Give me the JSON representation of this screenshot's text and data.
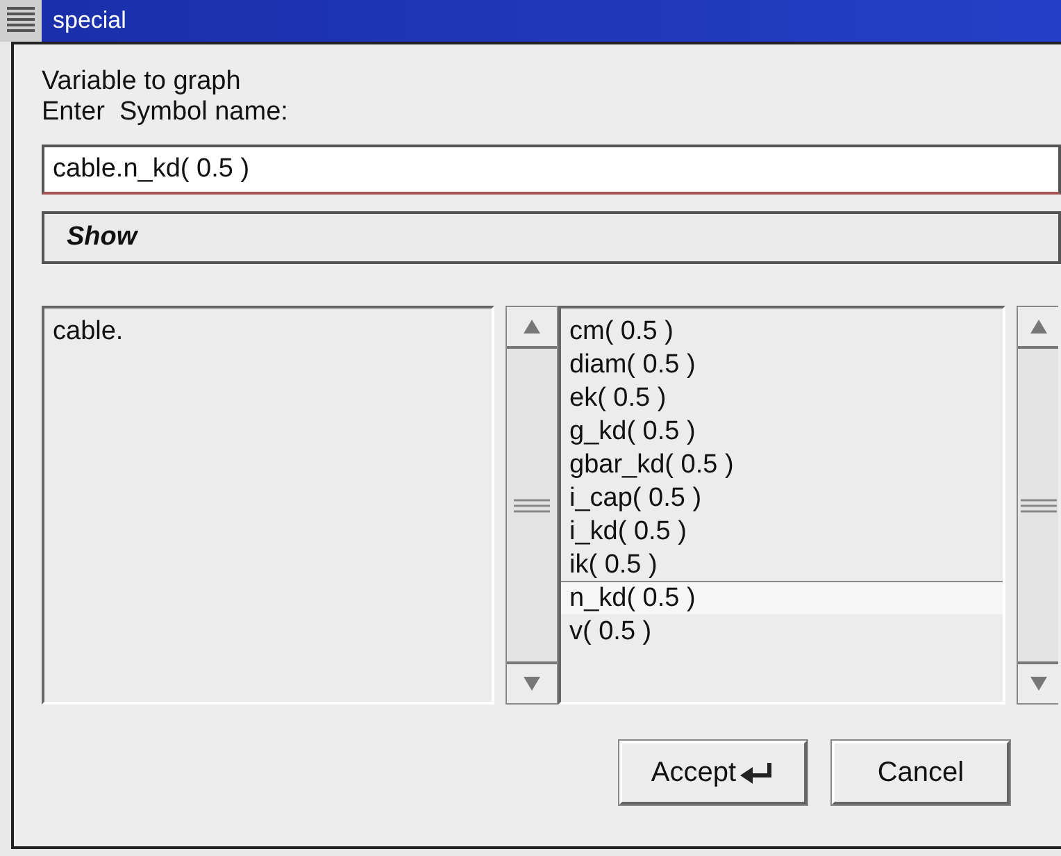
{
  "window": {
    "title": "special"
  },
  "prompt": [
    "Variable to graph",
    "Enter  Symbol name:"
  ],
  "symbol_field": {
    "value": "cable.n_kd( 0.5 )"
  },
  "show_button": "Show",
  "left_list": {
    "items": [
      {
        "label": "cable.",
        "selected": false
      }
    ]
  },
  "right_list": {
    "items": [
      {
        "label": "cm( 0.5 )",
        "selected": false
      },
      {
        "label": "diam( 0.5 )",
        "selected": false
      },
      {
        "label": "ek( 0.5 )",
        "selected": false
      },
      {
        "label": "g_kd( 0.5 )",
        "selected": false
      },
      {
        "label": "gbar_kd( 0.5 )",
        "selected": false
      },
      {
        "label": "i_cap( 0.5 )",
        "selected": false
      },
      {
        "label": "i_kd( 0.5 )",
        "selected": false
      },
      {
        "label": "ik( 0.5 )",
        "selected": false
      },
      {
        "label": "n_kd( 0.5 )",
        "selected": true
      },
      {
        "label": "v( 0.5 )",
        "selected": false
      }
    ]
  },
  "buttons": [
    "Accept",
    "Cancel"
  ]
}
